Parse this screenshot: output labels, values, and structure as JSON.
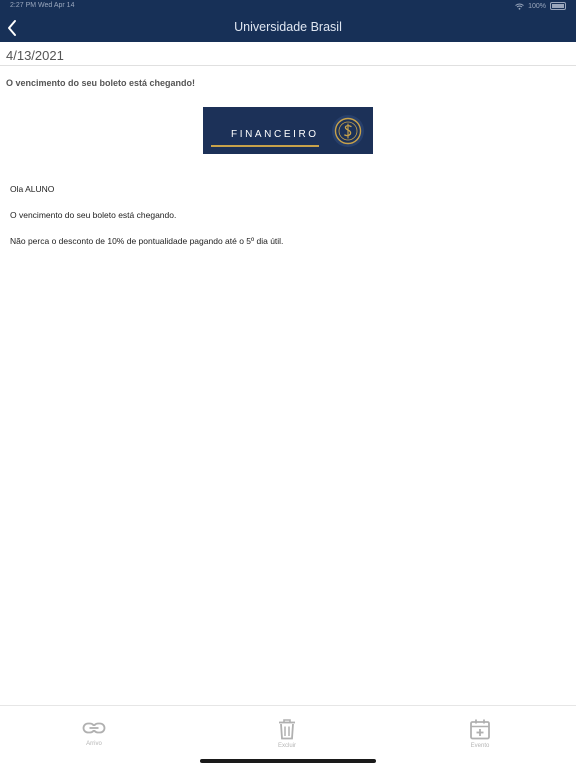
{
  "status_bar": {
    "time_date": "2:27 PM   Wed Apr 14",
    "battery": "100%"
  },
  "header": {
    "title": "Universidade Brasil"
  },
  "message": {
    "date": "4/13/2021",
    "subject": "O vencimento do seu boleto está chegando!",
    "banner_text": "FINANCEIRO",
    "greeting": "Ola ALUNO",
    "line1": "O vencimento do seu boleto está chegando.",
    "line2": "Não perca o desconto de 10% de pontualidade pagando até o 5º dia útil."
  },
  "tabbar": {
    "items": [
      {
        "label": "Arrivo",
        "icon": "link-icon"
      },
      {
        "label": "Excluir",
        "icon": "trash-icon"
      },
      {
        "label": "Evento",
        "icon": "calendar-plus-icon"
      }
    ]
  },
  "colors": {
    "header_bg": "#173057",
    "banner_bg": "#1c3158",
    "accent_gold": "#c8a24a"
  }
}
